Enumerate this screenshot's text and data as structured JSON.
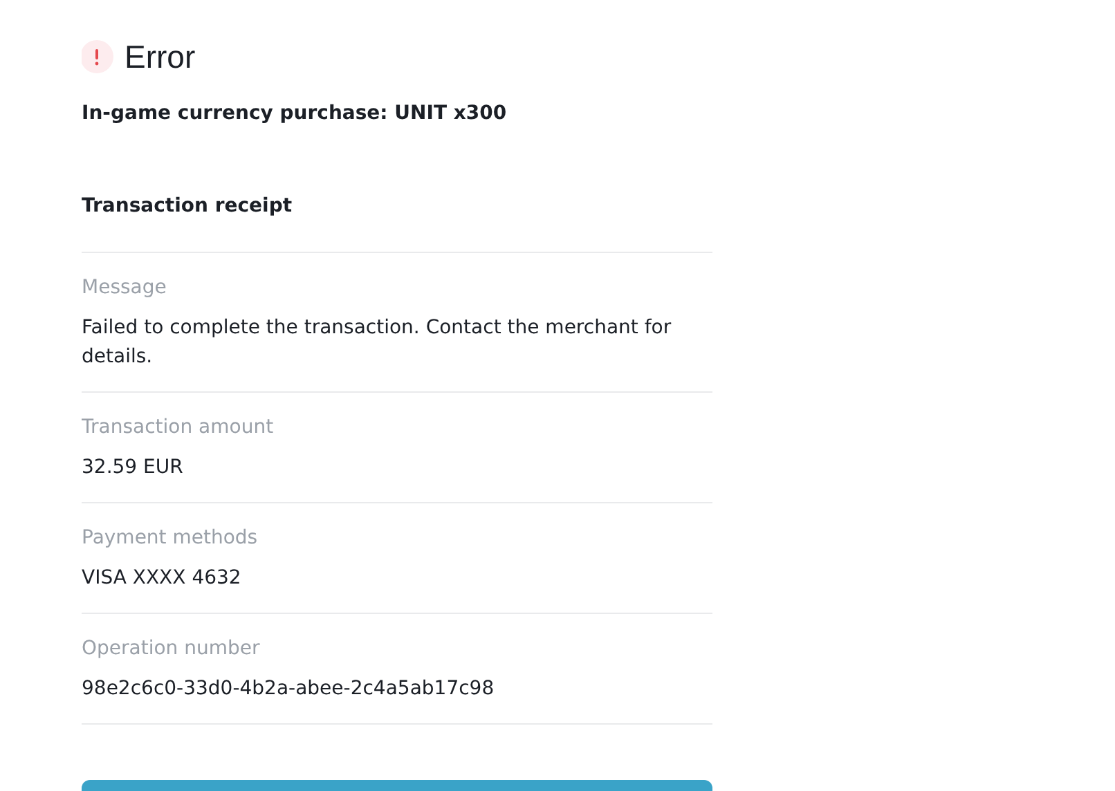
{
  "header": {
    "title": "Error"
  },
  "purchase": "In-game currency purchase: UNIT x300",
  "receipt": {
    "title": "Transaction receipt",
    "fields": [
      {
        "label": "Message",
        "value": "Failed to complete the transaction. Contact the merchant for details."
      },
      {
        "label": "Transaction amount",
        "value": "32.59 EUR"
      },
      {
        "label": "Payment methods",
        "value": "VISA XXXX 4632"
      },
      {
        "label": "Operation number",
        "value": "98e2c6c0-33d0-4b2a-abee-2c4a5ab17c98"
      }
    ]
  }
}
